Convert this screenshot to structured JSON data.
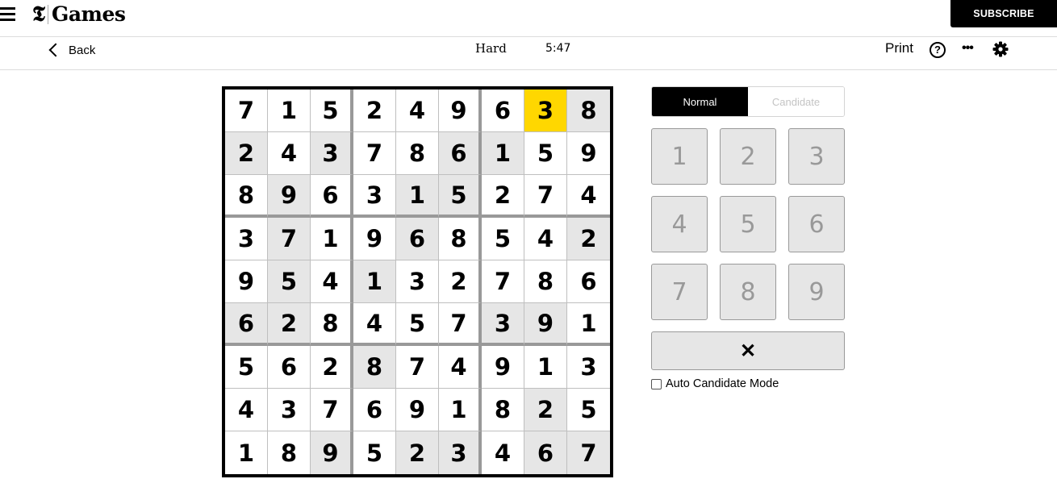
{
  "header": {
    "logo_mark": "𝕿",
    "logo_text": "Games",
    "subscribe_label": "SUBSCRIBE"
  },
  "toolbar": {
    "back_label": "Back",
    "difficulty": "Hard",
    "timer": "5:47",
    "print_label": "Print",
    "help_glyph": "?",
    "more_glyph": "•••",
    "icons": [
      "hamburger-menu-icon",
      "back-chevron-icon",
      "help-icon",
      "more-options-icon",
      "settings-gear-icon"
    ]
  },
  "board": {
    "rows": [
      [
        "7",
        "1",
        "5",
        "2",
        "4",
        "9",
        "6",
        "3",
        "8"
      ],
      [
        "2",
        "4",
        "3",
        "7",
        "8",
        "6",
        "1",
        "5",
        "9"
      ],
      [
        "8",
        "9",
        "6",
        "3",
        "1",
        "5",
        "2",
        "7",
        "4"
      ],
      [
        "3",
        "7",
        "1",
        "9",
        "6",
        "8",
        "5",
        "4",
        "2"
      ],
      [
        "9",
        "5",
        "4",
        "1",
        "3",
        "2",
        "7",
        "8",
        "6"
      ],
      [
        "6",
        "2",
        "8",
        "4",
        "5",
        "7",
        "3",
        "9",
        "1"
      ],
      [
        "5",
        "6",
        "2",
        "8",
        "7",
        "4",
        "9",
        "1",
        "3"
      ],
      [
        "4",
        "3",
        "7",
        "6",
        "9",
        "1",
        "8",
        "2",
        "5"
      ],
      [
        "1",
        "8",
        "9",
        "5",
        "2",
        "3",
        "4",
        "6",
        "7"
      ]
    ],
    "shading": [
      [
        "w",
        "w",
        "w",
        "w",
        "w",
        "w",
        "w",
        "s",
        "g"
      ],
      [
        "g",
        "w",
        "g",
        "w",
        "w",
        "g",
        "g",
        "w",
        "w"
      ],
      [
        "w",
        "g",
        "w",
        "w",
        "g",
        "g",
        "w",
        "w",
        "w"
      ],
      [
        "w",
        "g",
        "w",
        "w",
        "g",
        "w",
        "w",
        "w",
        "g"
      ],
      [
        "w",
        "g",
        "w",
        "g",
        "w",
        "w",
        "w",
        "w",
        "w"
      ],
      [
        "g",
        "g",
        "w",
        "w",
        "w",
        "w",
        "g",
        "g",
        "w"
      ],
      [
        "w",
        "w",
        "w",
        "g",
        "w",
        "w",
        "w",
        "w",
        "w"
      ],
      [
        "w",
        "w",
        "w",
        "w",
        "w",
        "w",
        "w",
        "g",
        "w"
      ],
      [
        "w",
        "w",
        "g",
        "w",
        "g",
        "g",
        "w",
        "g",
        "g"
      ]
    ],
    "selected_cell": {
      "row": 1,
      "col": 8
    },
    "colors": {
      "selected": "#ffd700",
      "shaded": "#e6e6e6",
      "plain": "#ffffff"
    }
  },
  "controls": {
    "modes": [
      {
        "label": "Normal",
        "active": true
      },
      {
        "label": "Candidate",
        "active": false
      }
    ],
    "keys": [
      "1",
      "2",
      "3",
      "4",
      "5",
      "6",
      "7",
      "8",
      "9"
    ],
    "erase_glyph": "✕",
    "auto_candidate_label": "Auto Candidate Mode",
    "auto_candidate_checked": false
  }
}
